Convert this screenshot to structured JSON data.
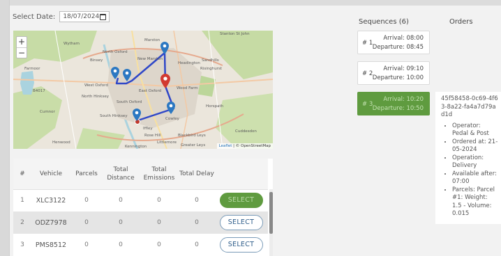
{
  "date": {
    "label": "Select Date:",
    "value": "18/07/2024"
  },
  "map": {
    "zoom_in": "+",
    "zoom_out": "−",
    "attribution_leaflet": "Leaflet",
    "attribution_osm": "| © OpenStreetMap",
    "place_labels": [
      "Wytham",
      "Marston",
      "Stanton St John",
      "North Oxford",
      "New Marston",
      "Headington",
      "Risinghurst",
      "Sandhills",
      "Farmoor",
      "West Oxford",
      "East Oxford",
      "Wood Farm",
      "Binsey",
      "South Oxford",
      "North Hinksey",
      "Cumnor",
      "South Hinksey",
      "Iffley",
      "Rose Hill",
      "Cowley",
      "Horspath",
      "Littlemore",
      "Blackbird Leys",
      "Kennington",
      "Greater Leys",
      "Cuddesdon",
      "Henwood",
      "B4017"
    ]
  },
  "table": {
    "columns": [
      "#",
      "Vehicle",
      "Parcels",
      "Total Distance",
      "Total Emissions",
      "Total Delay",
      ""
    ],
    "rows": [
      {
        "index": "1",
        "vehicle": "XLC3122",
        "parcels": "0",
        "distance": "0",
        "emissions": "0",
        "delay": "0",
        "action": "SELECT",
        "selected": true
      },
      {
        "index": "2",
        "vehicle": "ODZ7978",
        "parcels": "0",
        "distance": "0",
        "emissions": "0",
        "delay": "0",
        "action": "SELECT",
        "selected": false
      },
      {
        "index": "3",
        "vehicle": "PMS8512",
        "parcels": "0",
        "distance": "0",
        "emissions": "0",
        "delay": "0",
        "action": "SELECT",
        "selected": false
      }
    ]
  },
  "sequences": {
    "title": "Sequences (6)",
    "items": [
      {
        "number": "# 1",
        "arrival": "Arrival: 08:00",
        "departure": "Departure: 08:45",
        "active": false
      },
      {
        "number": "# 2",
        "arrival": "Arrival: 09:10",
        "departure": "Departure: 10:00",
        "active": false
      },
      {
        "number": "# 3",
        "arrival": "Arrival: 10:20",
        "departure": "Departure: 10:50",
        "active": true
      }
    ]
  },
  "orders": {
    "title": "Orders",
    "id": "45f58458-0c69-4f63-8a22-fa4a7d79ad1d",
    "details": [
      "Operator: Pedal & Post",
      "Ordered at: 21-05-2024",
      "Operation: Delivery",
      "Available after: 07:00",
      "Parcels: Parcel #1: Weight: 1.5 - Volume: 0.015"
    ]
  },
  "colors": {
    "accent_green": "#5f9b3f",
    "route_blue": "#2f47c8",
    "marker_blue": "#2c78c2",
    "marker_red": "#d23a30"
  }
}
